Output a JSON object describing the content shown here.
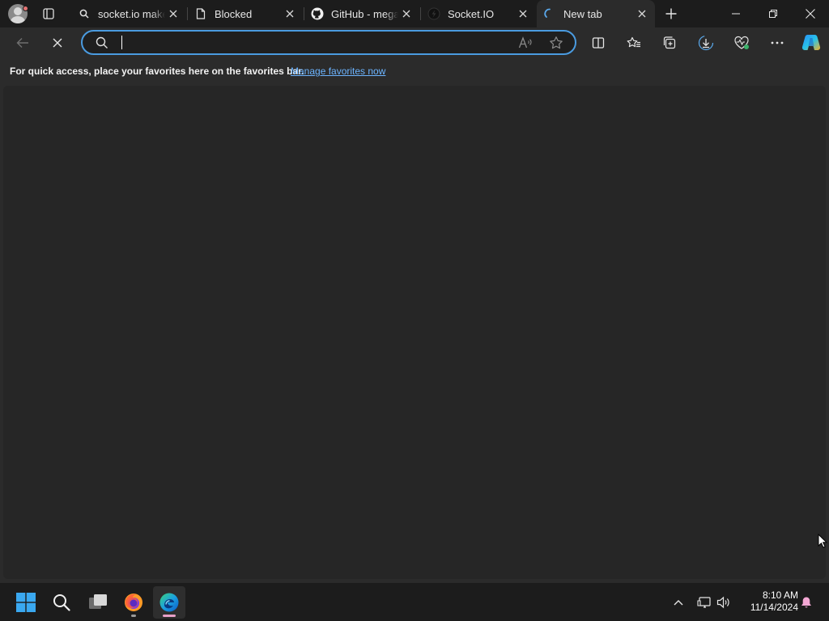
{
  "browser": {
    "tabs": [
      {
        "title": "socket.io makes",
        "favicon": "search-icon",
        "active": false
      },
      {
        "title": "Blocked",
        "favicon": "page-icon",
        "active": false
      },
      {
        "title": "GitHub - megal",
        "favicon": "github-icon",
        "active": false
      },
      {
        "title": "Socket.IO",
        "favicon": "socketio-icon",
        "active": false
      },
      {
        "title": "New tab",
        "favicon": "loading-spinner-icon",
        "active": true
      }
    ],
    "address_bar": {
      "value": "",
      "placeholder": ""
    },
    "favorites_bar": {
      "message": "For quick access, place your favorites here on the favorites bar.",
      "link_label": "Manage favorites now"
    },
    "colors": {
      "accent": "#4a9be0",
      "link": "#6cb4ff",
      "chrome": "#2b2b2b",
      "content": "#262626"
    }
  },
  "taskbar": {
    "pinned": [
      "windows-start-icon",
      "search-icon",
      "task-view-icon",
      "firefox-icon",
      "edge-icon"
    ],
    "clock": {
      "time": "8:10 AM",
      "date": "11/14/2024"
    }
  }
}
